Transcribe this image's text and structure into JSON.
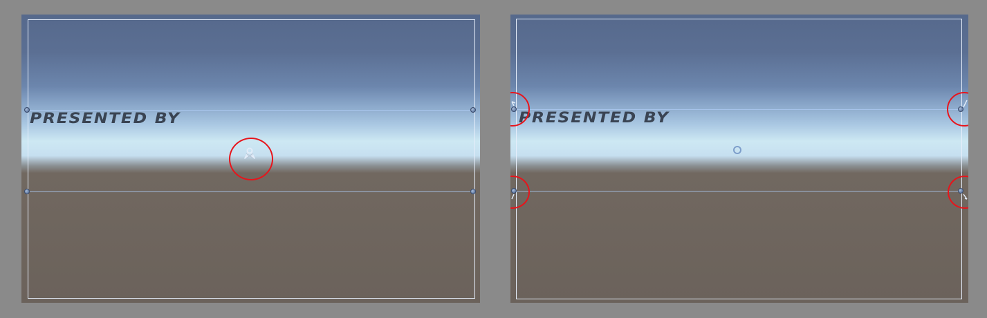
{
  "left_view": {
    "text_label": "PRESENTED BY",
    "highlight": "anchor-presets-icon"
  },
  "right_view": {
    "text_label": "PRESENTED BY",
    "highlight": "anchor-corner-handles"
  },
  "colors": {
    "highlight_circle": "#e8141b",
    "rect_outline": "#e6eefb",
    "anchor_line": "#aac8f0",
    "text": "#3a4453",
    "ground": "#6b625b",
    "sky_top": "#56698c"
  }
}
